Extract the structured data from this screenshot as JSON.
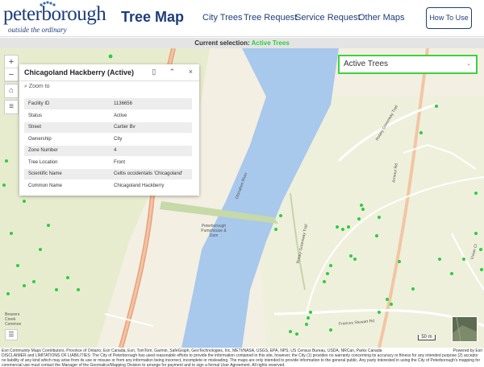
{
  "header": {
    "logo_word": "peterborough",
    "logo_tagline": "outside the ordinary",
    "app_title": "Tree Map",
    "nav": [
      {
        "label": "City Trees"
      },
      {
        "label": "Tree Request"
      },
      {
        "label": "Service Request"
      },
      {
        "label": "Other Maps"
      }
    ],
    "how_to_label": "How To Use"
  },
  "selection_bar": {
    "prefix": "Current selection:",
    "value": "Active Trees"
  },
  "map": {
    "layer_dropdown": "Active Trees",
    "scale_label": "50 m",
    "labels": {
      "river": "Otonabee River",
      "pumphouse": "Peterborough Pumphouse & Dam",
      "beavers": "Beavers Creek Common",
      "rotary": "Rotary Greenway Trail",
      "armour": "Armour Rd",
      "rotary_upper": "Rotary Greenway Trail",
      "frances": "Frances Stewart Rd",
      "vivian": "Vivian Ct"
    },
    "colors": {
      "water": "#a8c8ec",
      "tree": "#2ecc40",
      "highlight": "#3cd23c"
    }
  },
  "popup": {
    "title": "Chicagoland Hackberry (Active)",
    "zoom_to": "Zoom to",
    "attributes": [
      {
        "key": "Facility ID",
        "value": "1136656"
      },
      {
        "key": "Status",
        "value": "Active"
      },
      {
        "key": "Street",
        "value": "Cartier Bv"
      },
      {
        "key": "Ownership",
        "value": "City"
      },
      {
        "key": "Zone Number",
        "value": "4"
      },
      {
        "key": "Tree Location",
        "value": "Front"
      },
      {
        "key": "Scientific Name",
        "value": "Celtis occidentalis 'Chicagoland'"
      },
      {
        "key": "Common Name",
        "value": "Chicagoland Hackberry"
      }
    ]
  },
  "footer": {
    "attribution": "Esri Community Maps Contributors, Province of Ontario, Esri Canada, Esri, TomTom, Garmin, SafeGraph, GeoTechnologies, Inc, METI/NASA, USGS, EPA, NPS, US Census Bureau, USDA, NRCan, Parks Canada",
    "powered_by": "Powered by Esri",
    "disclaimer": "DISCLAIMER and LIMITATIONS OF LIABILITIES: The City of Peterborough has used reasonable efforts to provide the information contained in this site, however, the City (1) provides no warranty concerning its accuracy or fitness for any intended purpose (2) accepts no liability of any kind which may arise from its use or misuse or from any information being incorrect, incomplete or misleading. The maps are only intended to provide information to the general public. Any party interested in using the City of Peterborough's mapping for commercial use must contact the Manager of the Geomatics/Mapping Division to arrange for payment and to sign a formal User Agreement. All rights reserved."
  }
}
